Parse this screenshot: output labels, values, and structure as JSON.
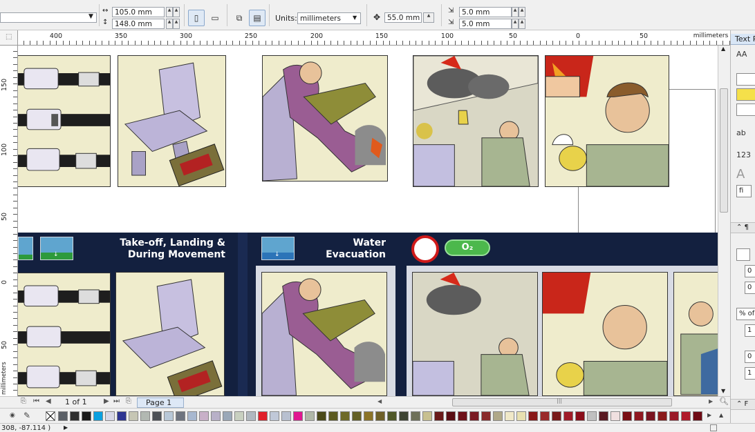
{
  "toolbar": {
    "paper_dropdown_value": "",
    "width_value": "105.0 mm",
    "height_value": "148.0 mm",
    "units_label": "Units:",
    "units_value": "millimeters",
    "nudge_value": "55.0 mm",
    "dup_x_value": "5.0 mm",
    "dup_y_value": "5.0 mm"
  },
  "ruler": {
    "unit_label": "millimeters",
    "h_ticks": [
      "400",
      "350",
      "300",
      "250",
      "200",
      "150",
      "100",
      "50",
      "0",
      "50"
    ],
    "v_ticks": [
      "150",
      "100",
      "50",
      "0",
      "50"
    ],
    "v_unit_label": "millimeters"
  },
  "canvas": {
    "panel_takeoff_title": "Take-off, Landing & During Movement",
    "panel_takeoff_line1": "Take-off, Landing &",
    "panel_takeoff_line2": "During Movement",
    "panel_water_line1": "Water",
    "panel_water_line2": "Evacuation",
    "o2_badge": "O₂"
  },
  "page_nav": {
    "page_count": "1 of 1",
    "page_tab": "Page 1"
  },
  "docker": {
    "title": "Text P",
    "items": [
      "AA",
      "ab",
      "123",
      "A",
      "fi"
    ],
    "fields": [
      "0",
      "0",
      "% of",
      "1",
      "0",
      "1"
    ]
  },
  "status": {
    "cursor_coords": "308, -87.114 )"
  },
  "palette": {
    "colors": [
      "#5a5f66",
      "#2e2e2e",
      "#1a1a1a",
      "#0aa0e0",
      "#d8d8e8",
      "#2e3592",
      "#c6c6b4",
      "#b2b8b2",
      "#4b4f55",
      "#b8c8d8",
      "#6e7480",
      "#a8b8d0",
      "#c8b0c8",
      "#b8b0c8",
      "#9aa8b8",
      "#c8d0c0",
      "#b0b8c0",
      "#e0202a",
      "#c0c8d8",
      "#b8c0d0",
      "#e01890",
      "#b0b8a8",
      "#4b4a1a",
      "#5c5a20",
      "#6e6a28",
      "#646024",
      "#8c7428",
      "#6e6028",
      "#505828",
      "#3e4432",
      "#6e7058",
      "#c8c090",
      "#6a1a1a",
      "#5a0e14",
      "#6e1018",
      "#7a1a22",
      "#8a2a2a",
      "#b0a888",
      "#f0e8c8",
      "#e8e0b0",
      "#8a1a1a",
      "#9a2a2a",
      "#7a1a1a",
      "#a01c28",
      "#8a0e1a",
      "#c0c0c0",
      "#5a1a22",
      "#f0e0e0",
      "#7a0e14",
      "#901820",
      "#7a1420",
      "#8a1a1a",
      "#9a1a28",
      "#b01a2a",
      "#6e0a14"
    ]
  }
}
